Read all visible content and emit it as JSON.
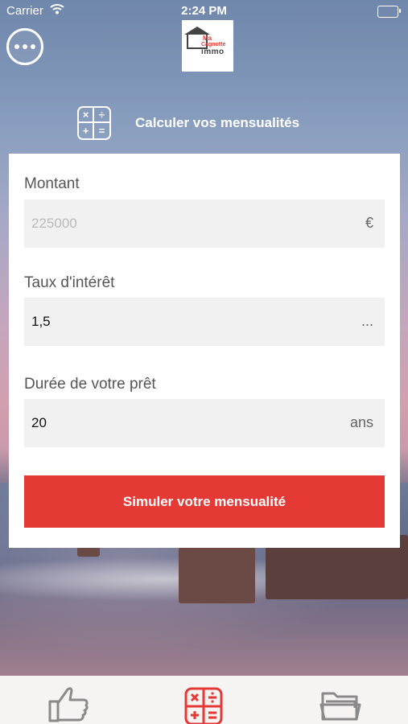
{
  "status_bar": {
    "carrier": "Carrier",
    "time": "2:24 PM"
  },
  "header": {
    "logo": {
      "line1": "Ma",
      "line2": "Cagnotte",
      "line3": "immo"
    }
  },
  "page": {
    "title": "Calculer vos mensualités"
  },
  "form": {
    "amount": {
      "label": "Montant",
      "placeholder": "225000",
      "suffix": "€"
    },
    "rate": {
      "label": "Taux d'intérêt",
      "value": "1,5",
      "suffix": "..."
    },
    "duration": {
      "label": "Durée de votre prêt",
      "value": "20",
      "suffix": "ans"
    },
    "submit_label": "Simuler votre mensualité"
  },
  "tab_bar": {
    "items": [
      {
        "icon": "thumbs-up-icon",
        "active": false
      },
      {
        "icon": "calculator-icon",
        "active": true
      },
      {
        "icon": "folder-icon",
        "active": false
      }
    ]
  },
  "colors": {
    "accent": "#e53935",
    "card": "#ffffff",
    "field_bg": "#f1f1f1"
  }
}
